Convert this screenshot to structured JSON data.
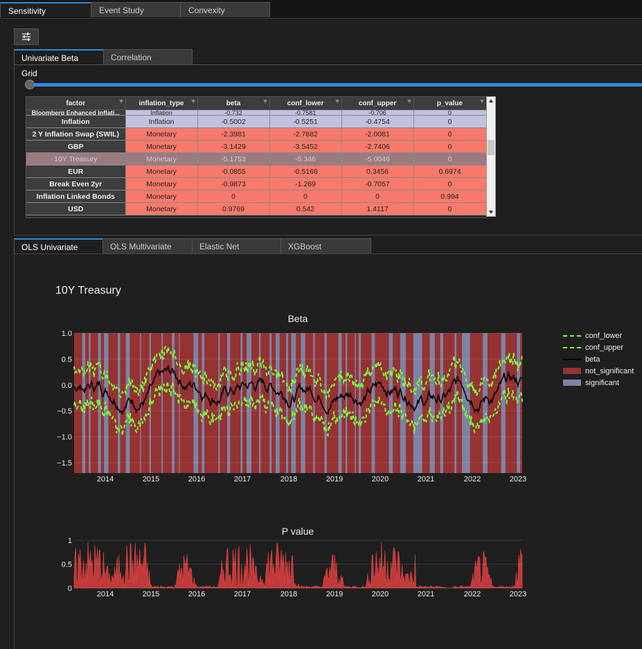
{
  "top_tabs": [
    "Sensitivity",
    "Event Study",
    "Convexity"
  ],
  "sub_tabs": [
    "Univariate Beta Grid",
    "Correlation"
  ],
  "model_tabs": [
    "OLS Univariate",
    "OLS Multivariate",
    "Elastic Net",
    "XGBoost"
  ],
  "grid": {
    "columns": [
      "factor",
      "inflation_type",
      "beta",
      "conf_lower",
      "conf_upper",
      "p_value"
    ],
    "cut_row": [
      "Bloomberg Enhanced Inflati...",
      "Inflation",
      "-0.732",
      "-0.7581",
      "-0.706",
      "0"
    ],
    "rows": [
      {
        "factor": "Inflation",
        "inflation_type": "Inflation",
        "beta": "-0.5002",
        "conf_lower": "-0.5251",
        "conf_upper": "-0.4754",
        "p_value": "0",
        "style": "blue"
      },
      {
        "factor": "2 Y Inflation Swap (SWIL)",
        "inflation_type": "Monetary",
        "beta": "-2.3981",
        "conf_lower": "-2.7882",
        "conf_upper": "-2.0081",
        "p_value": "0",
        "style": "red"
      },
      {
        "factor": "GBP",
        "inflation_type": "Monetary",
        "beta": "-3.1429",
        "conf_lower": "-3.5452",
        "conf_upper": "-2.7406",
        "p_value": "0",
        "style": "red"
      },
      {
        "factor": "10Y Treasury",
        "inflation_type": "Monetary",
        "beta": "-5.1753",
        "conf_lower": "-5.346",
        "conf_upper": "-5.0046",
        "p_value": "0",
        "style": "sel"
      },
      {
        "factor": "EUR",
        "inflation_type": "Monetary",
        "beta": "-0.0855",
        "conf_lower": "-0.5166",
        "conf_upper": "0.3456",
        "p_value": "0.6974",
        "style": "red"
      },
      {
        "factor": "Break Even 2yr",
        "inflation_type": "Monetary",
        "beta": "-0.9873",
        "conf_lower": "-1.269",
        "conf_upper": "-0.7057",
        "p_value": "0",
        "style": "red"
      },
      {
        "factor": "Inflation Linked Bonds",
        "inflation_type": "Monetary",
        "beta": "0",
        "conf_lower": "0",
        "conf_upper": "0",
        "p_value": "0.994",
        "style": "red"
      },
      {
        "factor": "USD",
        "inflation_type": "Monetary",
        "beta": "0.9769",
        "conf_lower": "0.542",
        "conf_upper": "1.4117",
        "p_value": "0",
        "style": "red"
      }
    ]
  },
  "page_title": "10Y Treasury",
  "legend": [
    "conf_lower",
    "conf_upper",
    "beta",
    "not_significant",
    "significant"
  ],
  "colors": {
    "accent": "#2b8de0",
    "conf": "#7cfc3c",
    "beta": "#000000",
    "not_significant": "#963232",
    "significant": "#7c84a6",
    "pvalue": "#c03a3a"
  },
  "chart_data": [
    {
      "type": "line",
      "title": "Beta",
      "x_labels": [
        "2014",
        "2015",
        "2016",
        "2017",
        "2018",
        "2019",
        "2020",
        "2021",
        "2022",
        "2023"
      ],
      "ylim": [
        -1.7,
        1.0
      ],
      "y_ticks": [
        "1.0",
        "0.5",
        "0.0",
        "−0.5",
        "−1.0",
        "−1.5"
      ],
      "series": [
        {
          "name": "conf_lower"
        },
        {
          "name": "conf_upper"
        },
        {
          "name": "beta"
        },
        {
          "name": "not_significant"
        },
        {
          "name": "significant"
        }
      ]
    },
    {
      "type": "area",
      "title": "P value",
      "x_labels": [
        "2014",
        "2015",
        "2016",
        "2017",
        "2018",
        "2019",
        "2020",
        "2021",
        "2022",
        "2023"
      ],
      "ylim": [
        0,
        1
      ],
      "y_ticks": [
        "1",
        "0.5",
        "0"
      ]
    }
  ]
}
